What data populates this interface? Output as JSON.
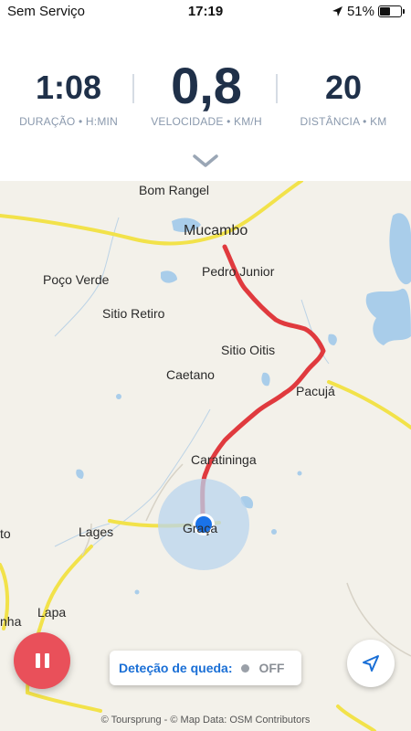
{
  "status_bar": {
    "carrier": "Sem Serviço",
    "time": "17:19",
    "battery": "51%",
    "battery_level": 0.51,
    "icons": [
      "location-arrow-icon",
      "battery-icon"
    ]
  },
  "stats": {
    "duration": {
      "value": "1:08",
      "label": "DURAÇÃO • H:MIN"
    },
    "speed": {
      "value": "0,8",
      "label": "VELOCIDADE • KM/H"
    },
    "distance": {
      "value": "20",
      "label": "DISTÂNCIA • KM"
    }
  },
  "map": {
    "places": [
      "Bom Rangel",
      "Mucambo",
      "Pedro Junior",
      "Poço Verde",
      "Sitio Retiro",
      "Sitio Oitis",
      "Caetano",
      "Pacujá",
      "Caratininga",
      "Lages",
      "Graça",
      "Lapa",
      "nha",
      "to"
    ],
    "attribution": "© Toursprung - © Map Data: OSM Contributors",
    "colors": {
      "route": "#e03a3e",
      "road": "#f2e24a",
      "water": "#a9cdea",
      "location": "#1a73e8"
    }
  },
  "controls": {
    "pause_icon": "pause-icon",
    "fall_detection_label": "Deteção de queda:",
    "fall_detection_state": "OFF",
    "locate_icon": "navigation-arrow-icon"
  }
}
